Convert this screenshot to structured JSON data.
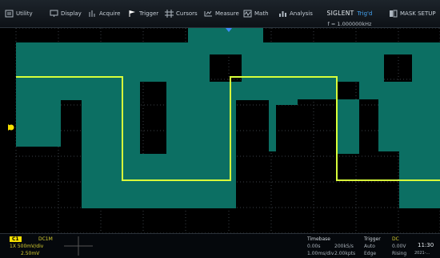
{
  "menu": {
    "utility": "Utility",
    "display": "Display",
    "acquire": "Acquire",
    "trigger": "Trigger",
    "cursors": "Cursors",
    "measure": "Measure",
    "math": "Math",
    "analysis": "Analysis",
    "mask_setup": "MASK SETUP"
  },
  "status": {
    "brand": "SIGLENT",
    "state": "Trig'd",
    "frequency": "f = 1.000000kHz"
  },
  "channel": {
    "label": "C1",
    "coupling": "DC1M",
    "scale": "1X  500mV/div",
    "offset": "2.50mV"
  },
  "timebase": {
    "title": "Timebase",
    "delay": "0.00s",
    "rate": "200kS/s",
    "scale": "1.00ms/div",
    "memory": "2.00kpts"
  },
  "trigger": {
    "title": "Trigger",
    "coupling": "DC",
    "level": "0.00V",
    "mode": "Auto",
    "type": "Edge",
    "slope": "Rising"
  },
  "clock": {
    "time": "11:30",
    "date": "2021-..."
  },
  "colors": {
    "trace": "#d8ff3a",
    "mask": "#0c6f63",
    "grid": "#3a3f46",
    "channel": "#f5e000",
    "trigger_marker": "#3d8bff"
  }
}
